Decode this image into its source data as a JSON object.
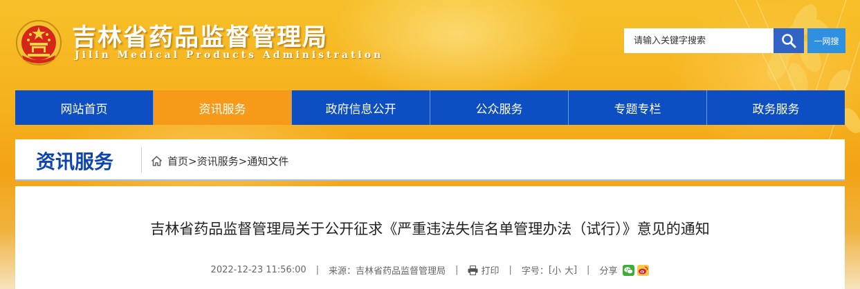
{
  "header": {
    "site_title": "吉林省药品监督管理局",
    "site_subtitle": "Jilin Medical Products Administration",
    "search_placeholder": "请输入关键字搜索",
    "yiwangsou_label": "一网搜"
  },
  "nav": {
    "items": [
      {
        "label": "网站首页"
      },
      {
        "label": "资讯服务"
      },
      {
        "label": "政府信息公开"
      },
      {
        "label": "公众服务"
      },
      {
        "label": "专题专栏"
      },
      {
        "label": "政务服务"
      }
    ],
    "active_index": 1
  },
  "section": {
    "title": "资讯服务",
    "breadcrumb": {
      "home": "首页",
      "sep1": ">",
      "level1": "资讯服务",
      "sep2": ">",
      "level2": "通知文件"
    }
  },
  "article": {
    "title": "吉林省药品监督管理局关于公开征求《严重违法失信名单管理办法（试行）》意见的通知",
    "date": "2022-12-23 11:56:00",
    "source_label": "来源：",
    "source_value": "吉林省药品监督管理局",
    "print_label": "打印",
    "font_size_label": "字号：",
    "font_size_open": "[",
    "font_size_small": "小",
    "font_size_large": "大",
    "font_size_close": "]",
    "share_label": "分享",
    "divider": "|"
  },
  "colors": {
    "nav_blue": "#0d4fc3",
    "nav_active_orange": "#f79a19",
    "section_title_blue": "#0d44b0",
    "search_button_blue": "#2f63c6",
    "yiwangsou_blue": "#2f8fe0",
    "wechat_green": "#3cb034",
    "weibo_red": "#e6162d"
  },
  "icons": {
    "emblem": "national-emblem-icon",
    "search": "search-icon",
    "home": "home-icon",
    "print": "print-icon",
    "wechat": "wechat-icon",
    "weibo": "weibo-icon"
  }
}
